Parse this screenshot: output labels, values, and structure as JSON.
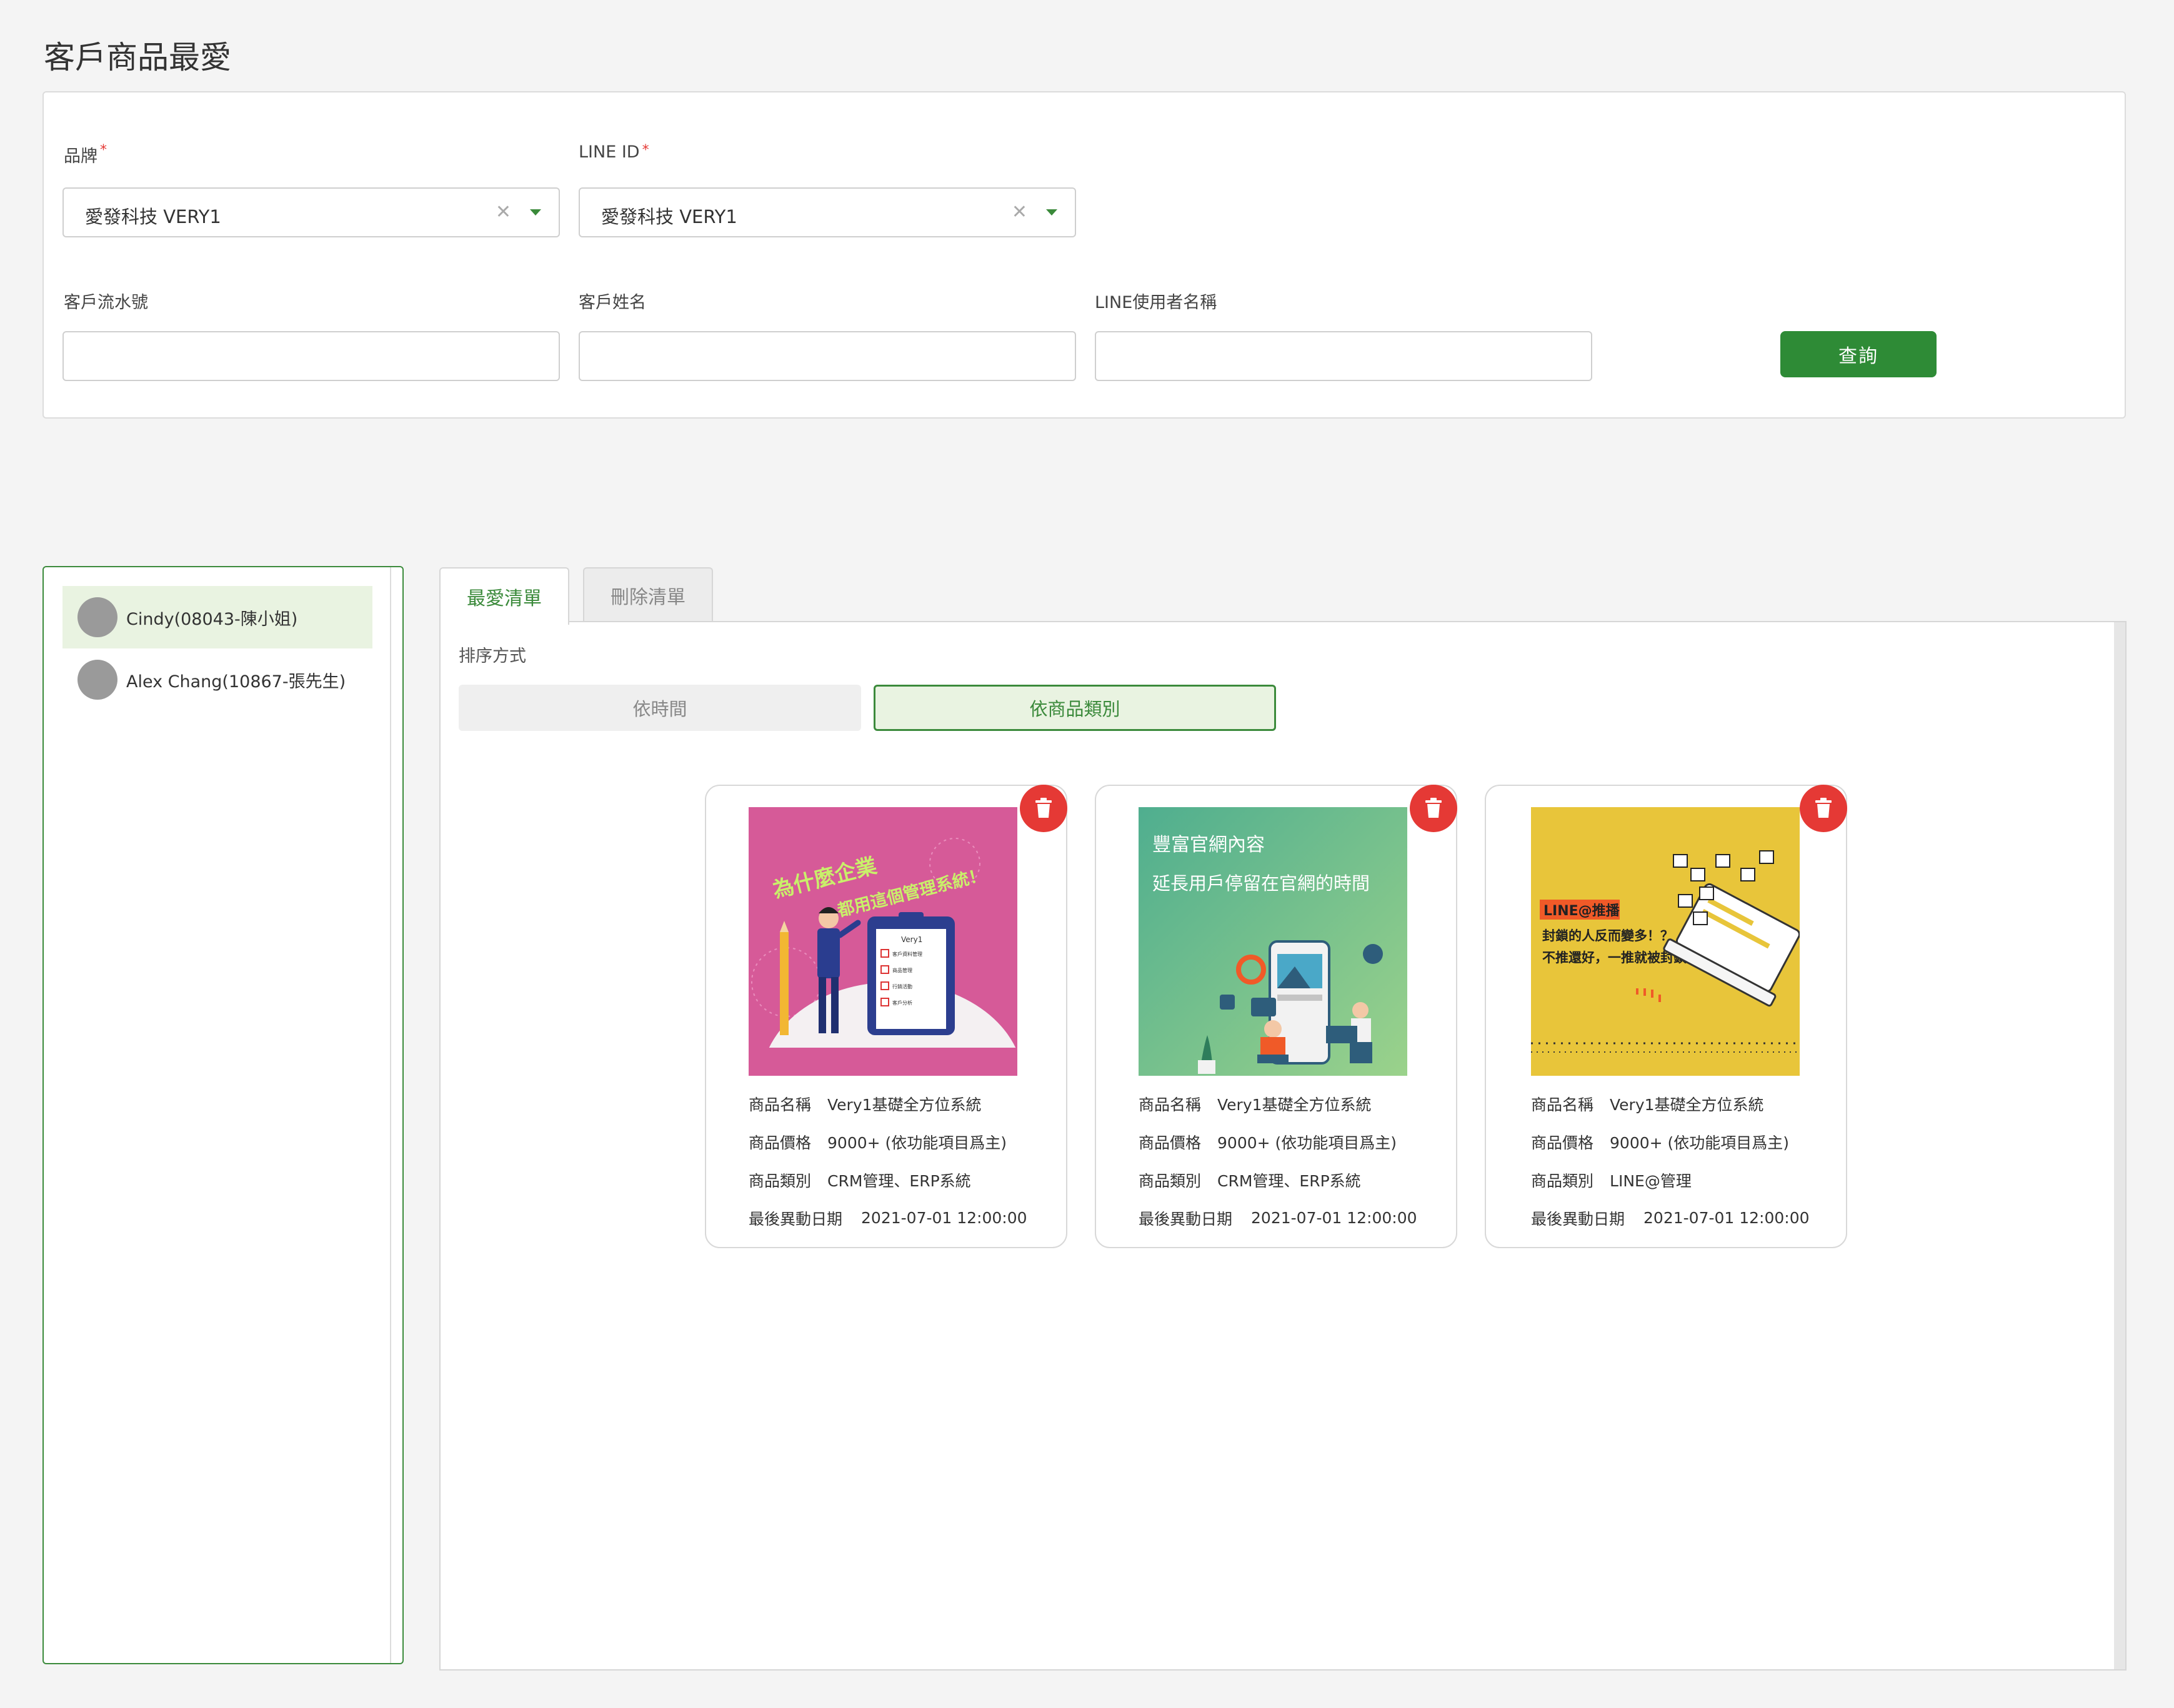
{
  "page": {
    "title": "客戶商品最愛"
  },
  "filters": {
    "brand": {
      "label": "品牌",
      "required": "*",
      "value": "愛發科技 VERY1",
      "clear": "✕"
    },
    "line_id": {
      "label": "LINE ID",
      "required": "*",
      "value": "愛發科技 VERY1",
      "clear": "✕"
    },
    "customer_serial": {
      "label": "客戶流水號",
      "value": ""
    },
    "customer_name": {
      "label": "客戶姓名",
      "value": ""
    },
    "line_user_name": {
      "label": "LINE使用者名稱",
      "value": ""
    },
    "query_label": "查詢"
  },
  "customers": [
    {
      "name": "Cindy(08043-陳小姐)",
      "active": true
    },
    {
      "name": "Alex Chang(10867-張先生)",
      "active": false
    }
  ],
  "tabs": [
    {
      "label": "最愛清單",
      "active": true
    },
    {
      "label": "刪除清單",
      "active": false
    }
  ],
  "sort": {
    "label": "排序方式",
    "options": [
      {
        "label": "依時間",
        "selected": false
      },
      {
        "label": "依商品類別",
        "selected": true
      }
    ]
  },
  "products": [
    {
      "image": {
        "type": "pink-checklist",
        "line1": "為什麼企業",
        "line2": "都用這個管理系統！",
        "brand": "Very1",
        "checklist": [
          "客戶資料管理",
          "商品管理",
          "行銷活動",
          "客戶分析"
        ],
        "bg": "#d65a98"
      },
      "fields": [
        {
          "key": "商品名稱",
          "value": "Very1基礎全方位系統"
        },
        {
          "key": "商品價格",
          "value": "9000+ (依功能項目爲主)"
        },
        {
          "key": "商品類別",
          "value": "CRM管理、ERP系統"
        },
        {
          "key": "最後異動日期",
          "value": "2021-07-01 12:00:00"
        }
      ]
    },
    {
      "image": {
        "type": "green-website",
        "line1": "豐富官網內容",
        "line2": "延長用戶停留在官網的時間",
        "bg": "#6fb89a"
      },
      "fields": [
        {
          "key": "商品名稱",
          "value": "Very1基礎全方位系統"
        },
        {
          "key": "商品價格",
          "value": "9000+ (依功能項目爲主)"
        },
        {
          "key": "商品類別",
          "value": "CRM管理、ERP系統"
        },
        {
          "key": "最後異動日期",
          "value": "2021-07-01 12:00:00"
        }
      ]
    },
    {
      "image": {
        "type": "yellow-line",
        "tag": "LINE@推播",
        "line1": "封鎖的人反而變多！？",
        "line2": "不推還好，一推就被封鎖。",
        "bg": "#e8c53a"
      },
      "fields": [
        {
          "key": "商品名稱",
          "value": "Very1基礎全方位系統"
        },
        {
          "key": "商品價格",
          "value": "9000+ (依功能項目爲主)"
        },
        {
          "key": "商品類別",
          "value": "LINE@管理"
        },
        {
          "key": "最後異動日期",
          "value": "2021-07-01 12:00:00"
        }
      ]
    }
  ],
  "colors": {
    "accent": "#3b8a3b",
    "button": "#2e8b36",
    "danger": "#e53935",
    "active_bg": "#e9f3e1"
  }
}
